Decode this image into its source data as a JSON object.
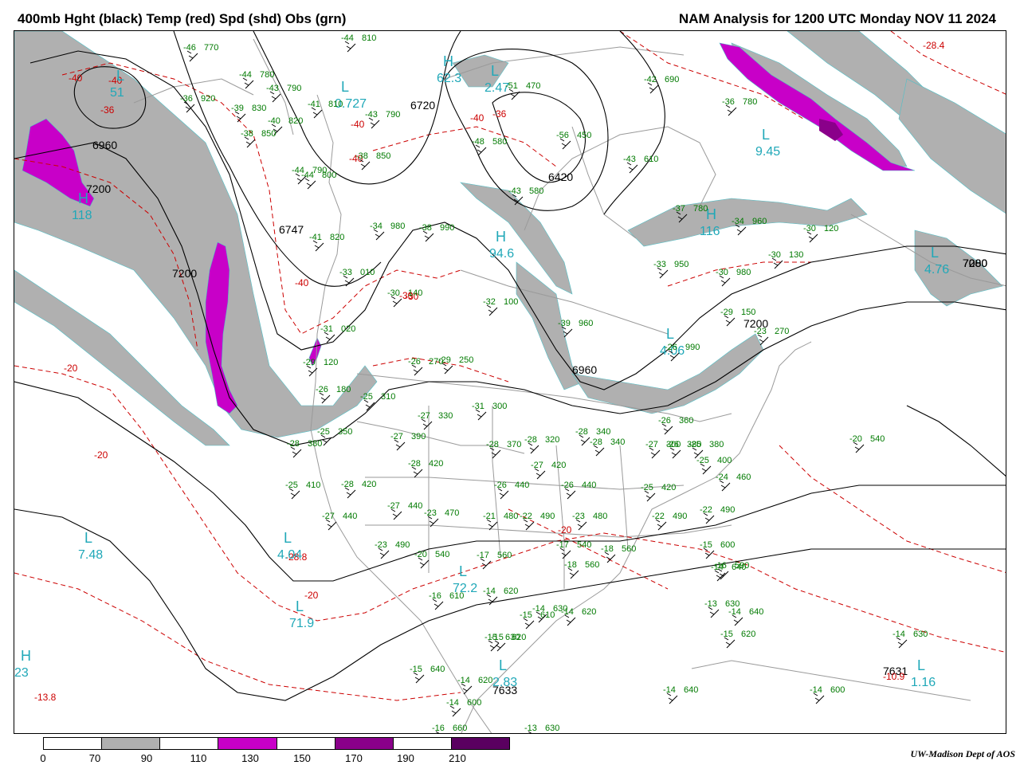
{
  "header": {
    "left": "400mb Hght (black) Temp (red) Spd (shd) Obs (grn)",
    "right": "NAM Analysis for 1200 UTC Monday  NOV 11 2024"
  },
  "credit": "UW-Madison  Dept of AOS",
  "legend": {
    "ticks": [
      "0",
      "70",
      "90",
      "110",
      "130",
      "150",
      "170",
      "190",
      "210"
    ],
    "segments": [
      {
        "range": "0-70",
        "color": "#ffffff"
      },
      {
        "range": "70-90",
        "color": "#b0b0b0"
      },
      {
        "range": "90-110",
        "color": "#ffffff"
      },
      {
        "range": "110-130",
        "color": "#c800c8"
      },
      {
        "range": "130-150",
        "color": "#ffffff"
      },
      {
        "range": "150-170",
        "color": "#8a008a"
      },
      {
        "range": "170-190",
        "color": "#ffffff"
      },
      {
        "range": "190-210",
        "color": "#5a0060"
      }
    ]
  },
  "colors": {
    "height": "#000000",
    "temp": "#cc0000",
    "obs": "#007a00",
    "centers": "#20a8b8",
    "speed_70": "#b0b0b0",
    "speed_110": "#c800c8",
    "geography": "#9a9a9a"
  },
  "height_labels": [
    "6960",
    "7200",
    "6747",
    "6720",
    "6420",
    "7080",
    "7200",
    "7200",
    "6960",
    "7200",
    "7080",
    "7633",
    "7631"
  ],
  "temp_labels": [
    "-40",
    "-40",
    "-36",
    "-40",
    "-40",
    "-40",
    "-40",
    "-36",
    "-30",
    "-30",
    "-20",
    "-20",
    "-20",
    "-20",
    "-28.4",
    "-28.8",
    "-13.8",
    "-10.9"
  ],
  "centers": [
    {
      "type": "L",
      "value": "51"
    },
    {
      "type": "H",
      "value": "118"
    },
    {
      "type": "L",
      "value": "0.727"
    },
    {
      "type": "H",
      "value": "62.3"
    },
    {
      "type": "L",
      "value": "2.47"
    },
    {
      "type": "L",
      "value": "9.45"
    },
    {
      "type": "H",
      "value": "94.6"
    },
    {
      "type": "H",
      "value": "116"
    },
    {
      "type": "L",
      "value": "4.76"
    },
    {
      "type": "L",
      "value": "4.06"
    },
    {
      "type": "L",
      "value": "7.48"
    },
    {
      "type": "L",
      "value": "4.04"
    },
    {
      "type": "L",
      "value": "71.9"
    },
    {
      "type": "L",
      "value": "72.2"
    },
    {
      "type": "L",
      "value": "2.83"
    },
    {
      "type": "L",
      "value": "1.16"
    },
    {
      "type": "H",
      "value": "23"
    }
  ],
  "obs": [
    {
      "t": "-46",
      "h": "770"
    },
    {
      "t": "-44",
      "h": "810"
    },
    {
      "t": "-44",
      "h": "780"
    },
    {
      "t": "-43",
      "h": "790"
    },
    {
      "t": "-36",
      "h": "920"
    },
    {
      "t": "-39",
      "h": "830"
    },
    {
      "t": "-41",
      "h": "810"
    },
    {
      "t": "-40",
      "h": "820"
    },
    {
      "t": "-43",
      "h": "790"
    },
    {
      "t": "-38",
      "h": "850"
    },
    {
      "t": "-44",
      "h": "790"
    },
    {
      "t": "-44",
      "h": "800"
    },
    {
      "t": "-38",
      "h": "850"
    },
    {
      "t": "-41",
      "h": "820"
    },
    {
      "t": "-48",
      "h": "580"
    },
    {
      "t": "-56",
      "h": "450"
    },
    {
      "t": "-51",
      "h": "470"
    },
    {
      "t": "-42",
      "h": "690"
    },
    {
      "t": "-36",
      "h": "780"
    },
    {
      "t": "-43",
      "h": "610"
    },
    {
      "t": "-43",
      "h": "580"
    },
    {
      "t": "-37",
      "h": "780"
    },
    {
      "t": "-34",
      "h": "960"
    },
    {
      "t": "-34",
      "h": "980"
    },
    {
      "t": "-38",
      "h": "990"
    },
    {
      "t": "-30",
      "h": "120"
    },
    {
      "t": "-30",
      "h": "130"
    },
    {
      "t": "-33",
      "h": "950"
    },
    {
      "t": "-30",
      "h": "980"
    },
    {
      "t": "-33",
      "h": "010"
    },
    {
      "t": "-30",
      "h": "140"
    },
    {
      "t": "-32",
      "h": "100"
    },
    {
      "t": "-39",
      "h": "960"
    },
    {
      "t": "-29",
      "h": "150"
    },
    {
      "t": "-23",
      "h": "270"
    },
    {
      "t": "-26",
      "h": "990"
    },
    {
      "t": "-31",
      "h": "020"
    },
    {
      "t": "-29",
      "h": "120"
    },
    {
      "t": "-26",
      "h": "270"
    },
    {
      "t": "-29",
      "h": "250"
    },
    {
      "t": "-26",
      "h": "180"
    },
    {
      "t": "-25",
      "h": "310"
    },
    {
      "t": "-31",
      "h": "300"
    },
    {
      "t": "-27",
      "h": "330"
    },
    {
      "t": "-27",
      "h": "390"
    },
    {
      "t": "-25",
      "h": "350"
    },
    {
      "t": "-28",
      "h": "380"
    },
    {
      "t": "-28",
      "h": "370"
    },
    {
      "t": "-28",
      "h": "320"
    },
    {
      "t": "-28",
      "h": "340"
    },
    {
      "t": "-28",
      "h": "340"
    },
    {
      "t": "-27",
      "h": "300"
    },
    {
      "t": "-26",
      "h": "360"
    },
    {
      "t": "-26",
      "h": "380"
    },
    {
      "t": "-25",
      "h": "380"
    },
    {
      "t": "-25",
      "h": "400"
    },
    {
      "t": "-24",
      "h": "460"
    },
    {
      "t": "-20",
      "h": "540"
    },
    {
      "t": "-25",
      "h": "410"
    },
    {
      "t": "-28",
      "h": "420"
    },
    {
      "t": "-28",
      "h": "420"
    },
    {
      "t": "-26",
      "h": "440"
    },
    {
      "t": "-27",
      "h": "420"
    },
    {
      "t": "-26",
      "h": "440"
    },
    {
      "t": "-25",
      "h": "420"
    },
    {
      "t": "-27",
      "h": "440"
    },
    {
      "t": "-27",
      "h": "440"
    },
    {
      "t": "-23",
      "h": "470"
    },
    {
      "t": "-21",
      "h": "480"
    },
    {
      "t": "-22",
      "h": "490"
    },
    {
      "t": "-23",
      "h": "480"
    },
    {
      "t": "-22",
      "h": "490"
    },
    {
      "t": "-22",
      "h": "490"
    },
    {
      "t": "-23",
      "h": "490"
    },
    {
      "t": "-20",
      "h": "540"
    },
    {
      "t": "-17",
      "h": "560"
    },
    {
      "t": "-17",
      "h": "540"
    },
    {
      "t": "-18",
      "h": "560"
    },
    {
      "t": "-18",
      "h": "560"
    },
    {
      "t": "-15",
      "h": "600"
    },
    {
      "t": "-16",
      "h": "590"
    },
    {
      "t": "-16",
      "h": "610"
    },
    {
      "t": "-14",
      "h": "620"
    },
    {
      "t": "-15",
      "h": "610"
    },
    {
      "t": "-14",
      "h": "620"
    },
    {
      "t": "-13",
      "h": "630"
    },
    {
      "t": "-14",
      "h": "640"
    },
    {
      "t": "-14",
      "h": "640"
    },
    {
      "t": "-15",
      "h": "620"
    },
    {
      "t": "-15",
      "h": "630"
    },
    {
      "t": "-14",
      "h": "630"
    },
    {
      "t": "-15",
      "h": "620"
    },
    {
      "t": "-14",
      "h": "640"
    },
    {
      "t": "-15",
      "h": "640"
    },
    {
      "t": "-14",
      "h": "620"
    },
    {
      "t": "-14",
      "h": "600"
    },
    {
      "t": "-16",
      "h": "660"
    },
    {
      "t": "-13",
      "h": "630"
    },
    {
      "t": "-14",
      "h": "600"
    },
    {
      "t": "-14",
      "h": "630"
    }
  ]
}
